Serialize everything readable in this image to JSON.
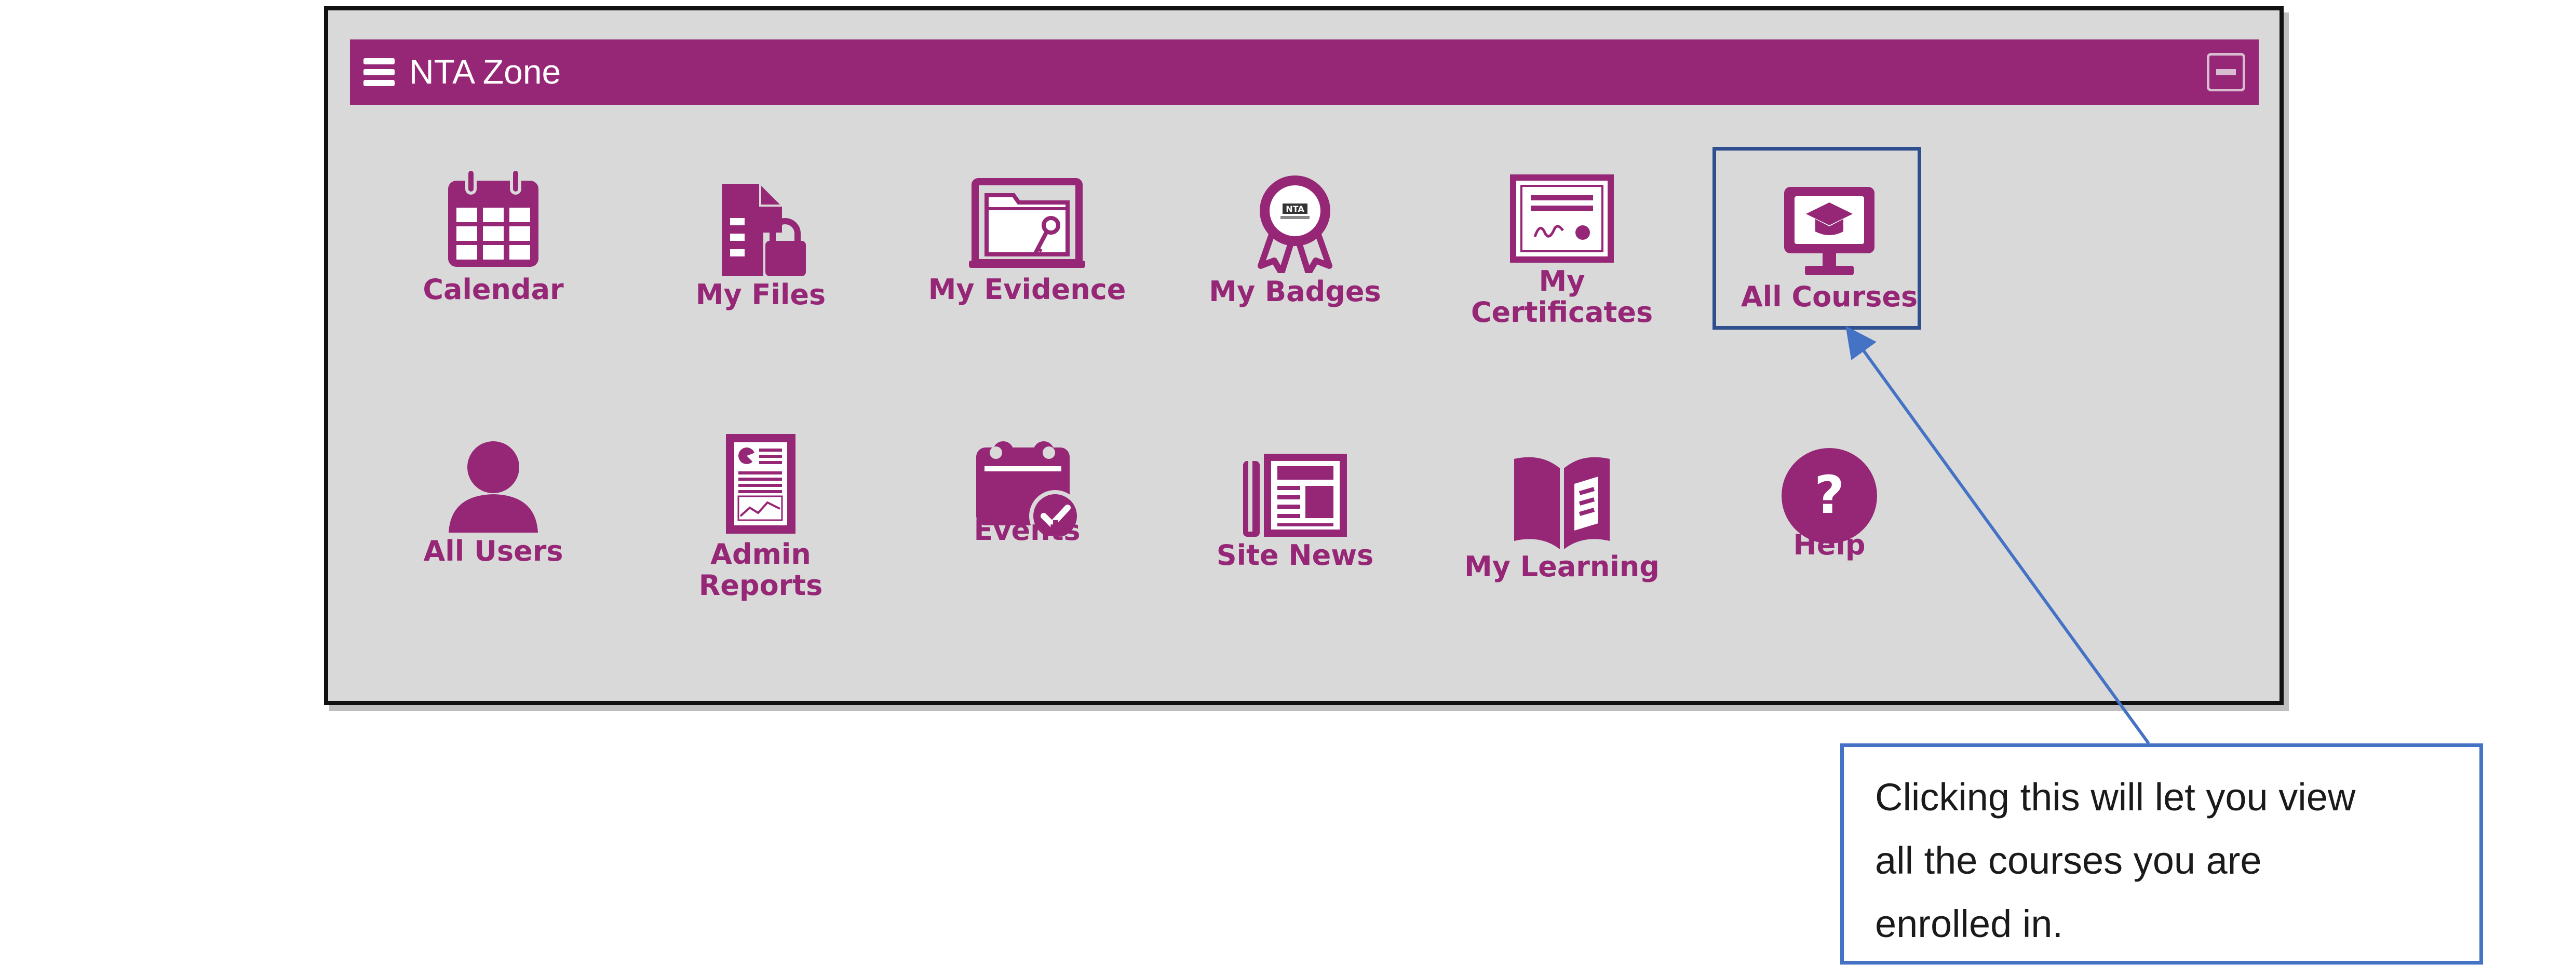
{
  "panel": {
    "title": "NTA Zone",
    "accent_color": "#962676",
    "background_color": "#d9d9d9"
  },
  "tiles": [
    {
      "label": "Calendar",
      "icon": "calendar-icon"
    },
    {
      "label": "My Files",
      "icon": "file-lock-icon"
    },
    {
      "label": "My Evidence",
      "icon": "evidence-folder-icon"
    },
    {
      "label": "My Badges",
      "icon": "badge-ribbon-icon"
    },
    {
      "label": "My Certificates",
      "label_lines": [
        "My",
        "Certificates"
      ],
      "icon": "certificate-icon"
    },
    {
      "label": "All Courses",
      "icon": "monitor-graduation-cap-icon"
    },
    {
      "label": "All Users",
      "icon": "user-icon"
    },
    {
      "label": "Admin Reports",
      "icon": "report-document-icon"
    },
    {
      "label": "Events",
      "icon": "calendar-check-icon"
    },
    {
      "label": "Site News",
      "icon": "newspaper-icon"
    },
    {
      "label": "My Learning",
      "icon": "open-book-icon"
    },
    {
      "label": "Help",
      "icon": "question-circle-icon"
    }
  ],
  "callout": {
    "lines": [
      "Clicking this will let you view",
      "all the courses you are",
      "enrolled in."
    ],
    "border_color": "#4472c4"
  },
  "highlight_color": "#2f4f8f"
}
